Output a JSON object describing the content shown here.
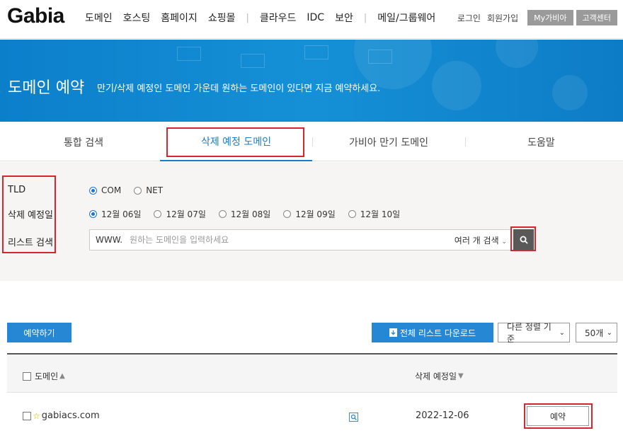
{
  "brand": {
    "logo": "Gabia"
  },
  "nav": {
    "menu": [
      "도메인",
      "호스팅",
      "홈페이지",
      "쇼핑몰",
      "클라우드",
      "IDC",
      "보안",
      "메일/그룹웨어"
    ],
    "login": "로그인",
    "signup": "회원가입",
    "my": "My가비아",
    "support": "고객센터"
  },
  "banner": {
    "title": "도메인 예약",
    "description": "만기/삭제 예정인 도메인 가운데 원하는 도메인이 있다면 지금 예약하세요."
  },
  "tabs": [
    {
      "label": "통합 검색",
      "active": false
    },
    {
      "label": "삭제 예정 도메인",
      "active": true
    },
    {
      "label": "가비아 만기 도메인",
      "active": false
    },
    {
      "label": "도움말",
      "active": false
    }
  ],
  "search": {
    "tld_label": "TLD",
    "tld_options": [
      {
        "label": "COM",
        "selected": true
      },
      {
        "label": "NET",
        "selected": false
      }
    ],
    "date_label": "삭제 예정일",
    "date_options": [
      {
        "label": "12월 06일",
        "selected": true
      },
      {
        "label": "12월 07일",
        "selected": false
      },
      {
        "label": "12월 08일",
        "selected": false
      },
      {
        "label": "12월 09일",
        "selected": false
      },
      {
        "label": "12월 10일",
        "selected": false
      }
    ],
    "list_label": "리스트 검색",
    "prefix": "WWW.",
    "placeholder": "원하는 도메인을 입력하세요",
    "multi_search": "여러 개 검색"
  },
  "actions": {
    "reserve": "예약하기",
    "download": "전체 리스트 다운로드",
    "sort": "다른 정렬 기준",
    "page_size": "50개"
  },
  "table": {
    "col_domain": "도메인",
    "col_date": "삭제 예정일",
    "rows": [
      {
        "domain": "gabiacs.com",
        "date": "2022-12-06",
        "action": "예약"
      }
    ]
  },
  "colors": {
    "brand_blue": "#1a7ccb",
    "highlight_red": "#d3262e"
  }
}
